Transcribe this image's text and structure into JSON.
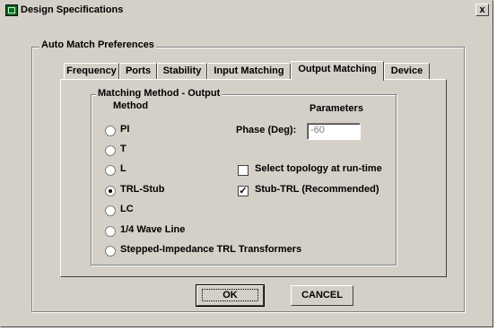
{
  "window": {
    "title": "Design Specifications",
    "close_label": "x"
  },
  "outer_group": {
    "label": "Auto Match Preferences"
  },
  "tabs": [
    {
      "label": "Frequency",
      "active": false
    },
    {
      "label": "Ports",
      "active": false
    },
    {
      "label": "Stability",
      "active": false
    },
    {
      "label": "Input Matching",
      "active": false
    },
    {
      "label": "Output Matching",
      "active": true
    },
    {
      "label": "Device",
      "active": false
    }
  ],
  "inner_group": {
    "label": "Matching Method - Output",
    "method_header": "Method",
    "parameters_header": "Parameters"
  },
  "methods": [
    {
      "label": "PI",
      "selected": false
    },
    {
      "label": "T",
      "selected": false
    },
    {
      "label": "L",
      "selected": false
    },
    {
      "label": "TRL-Stub",
      "selected": true
    },
    {
      "label": "LC",
      "selected": false
    },
    {
      "label": "1/4 Wave Line",
      "selected": false
    },
    {
      "label": "Stepped-Impedance TRL Transformers",
      "selected": false
    }
  ],
  "parameters": {
    "phase_label": "Phase (Deg):",
    "phase_value": "-60",
    "select_topology_label": "Select topology at run-time",
    "select_topology_checked": false,
    "stub_trl_label": "Stub-TRL (Recommended)",
    "stub_trl_checked": true
  },
  "buttons": {
    "ok_label": "OK",
    "cancel_label": "CANCEL"
  }
}
